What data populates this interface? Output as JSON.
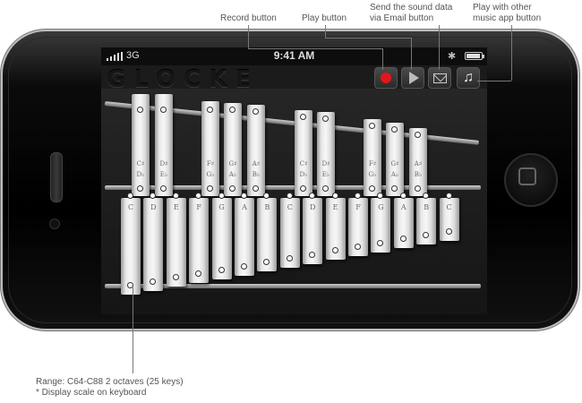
{
  "callouts": {
    "record": "Record button",
    "play": "Play button",
    "email_line1": "Send the sound data",
    "email_line2": "via Email button",
    "music_line1": "Play with other",
    "music_line2": "music app button"
  },
  "status_bar": {
    "network": "3G",
    "time": "9:41 AM"
  },
  "app": {
    "title": "GLOCKE"
  },
  "icons": {
    "record": "record-icon",
    "play": "play-icon",
    "email": "email-icon",
    "music": "music-note-icon",
    "bluetooth": "bluetooth-icon",
    "battery": "battery-icon",
    "signal": "signal-icon"
  },
  "accent_colors": {
    "record_red": "#e2161a"
  },
  "accidental_keys": [
    {
      "top": "C♯",
      "bottom": "D♭"
    },
    {
      "top": "D♯",
      "bottom": "E♭"
    },
    {
      "top": "F♯",
      "bottom": "G♭"
    },
    {
      "top": "G♯",
      "bottom": "A♭"
    },
    {
      "top": "A♯",
      "bottom": "B♭"
    },
    {
      "top": "C♯",
      "bottom": "D♭"
    },
    {
      "top": "D♯",
      "bottom": "E♭"
    },
    {
      "top": "F♯",
      "bottom": "G♭"
    },
    {
      "top": "G♯",
      "bottom": "A♭"
    },
    {
      "top": "A♯",
      "bottom": "B♭"
    }
  ],
  "natural_keys": [
    "C",
    "D",
    "E",
    "F",
    "G",
    "A",
    "B",
    "C",
    "D",
    "E",
    "F",
    "G",
    "A",
    "B",
    "C"
  ],
  "footer": {
    "line1": "Range: C64-C88 2 octaves (25 keys)",
    "line2": "* Display scale on keyboard"
  }
}
